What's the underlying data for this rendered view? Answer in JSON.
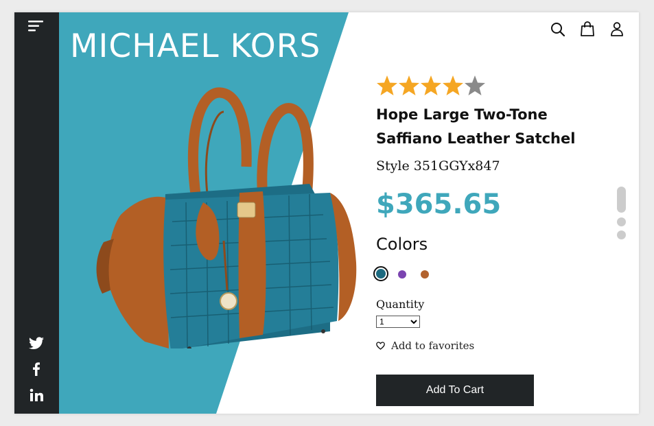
{
  "sidebar": {
    "menu_icon": "hamburger-menu-icon",
    "social": [
      {
        "name": "twitter",
        "icon": "twitter-icon"
      },
      {
        "name": "facebook",
        "icon": "facebook-icon"
      },
      {
        "name": "linkedin",
        "icon": "linkedin-icon"
      }
    ]
  },
  "hero": {
    "brand": "MICHAEL KORS",
    "accent_color": "#3fa7bb",
    "product_image": "teal-and-brown-handbag"
  },
  "header": {
    "icons": [
      "search-icon",
      "shopping-bag-icon",
      "user-icon"
    ]
  },
  "product": {
    "rating": 4,
    "rating_max": 5,
    "title": "Hope Large Two-Tone Saffiano Leather Satchel",
    "style": "Style 351GGYx847",
    "price": "$365.65",
    "colors_label": "Colors",
    "colors": [
      {
        "name": "teal",
        "hex": "#1c6a80",
        "selected": true
      },
      {
        "name": "purple",
        "hex": "#7b44b0",
        "selected": false
      },
      {
        "name": "brown",
        "hex": "#b2622e",
        "selected": false
      }
    ],
    "quantity_label": "Quantity",
    "quantity_value": "1",
    "favorites_label": "Add to favorites",
    "add_to_cart_label": "Add To Cart"
  },
  "gallery": {
    "slide_count": 3,
    "active_index": 0
  },
  "colors": {
    "sidebar": "#212527",
    "star_filled": "#f5a623",
    "star_empty": "#8a8a8a",
    "button": "#212527"
  }
}
